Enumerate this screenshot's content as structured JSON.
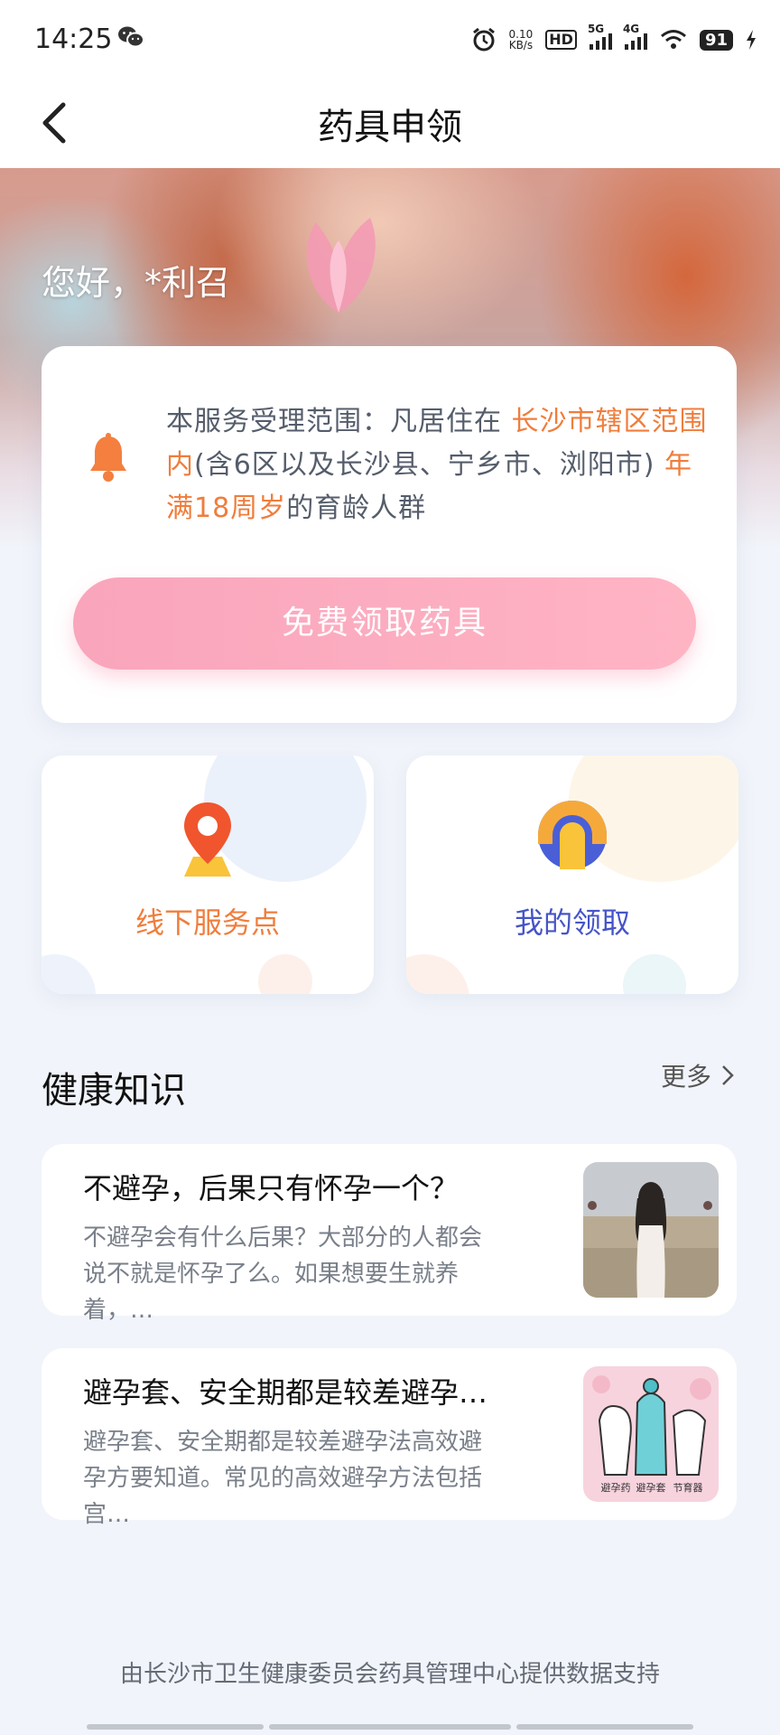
{
  "status_bar": {
    "time": "14:25",
    "net_speed_value": "0.10",
    "net_speed_unit": "KB/s",
    "hd_label": "HD",
    "signal_1": "5G",
    "signal_2": "4G",
    "battery": "91"
  },
  "header": {
    "title": "药具申领"
  },
  "hero": {
    "greeting": "您好，*利召"
  },
  "notice": {
    "part1": "本服务受理范围：凡居住在 ",
    "highlight1": "长沙市辖区范围内",
    "part2": "(含6区以及长沙县、宁乡市、浏阳市) ",
    "highlight2": "年满18周岁",
    "part3": "的育龄人群",
    "button_label": "免费领取药具"
  },
  "quick_links": {
    "offline": {
      "label": "线下服务点",
      "color": "#f07d3c"
    },
    "mine": {
      "label": "我的领取",
      "color": "#4554c8"
    }
  },
  "health": {
    "section_title": "健康知识",
    "more_label": "更多",
    "articles": [
      {
        "title": "不避孕，后果只有怀孕一个？",
        "summary": "不避孕会有什么后果？大部分的人都会说不就是怀孕了么。如果想要生就养着，…"
      },
      {
        "title": "避孕套、安全期都是较差避孕…",
        "summary": "避孕套、安全期都是较差避孕法高效避孕方要知道。常见的高效避孕方法包括宫…",
        "thumb_labels": [
          "避孕药",
          "避孕套",
          "节育器"
        ]
      }
    ]
  },
  "footer": {
    "text": "由长沙市卫生健康委员会药具管理中心提供数据支持"
  },
  "colors": {
    "accent_orange": "#f07d3c",
    "button_pink": "#f9a5bc",
    "mine_blue": "#4554c8"
  }
}
